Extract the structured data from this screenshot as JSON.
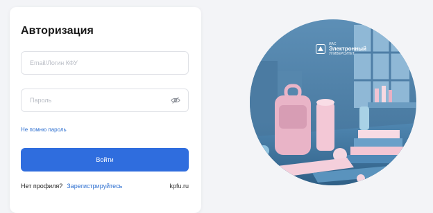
{
  "login": {
    "title": "Авторизация",
    "email_placeholder": "Email/Логин КФУ",
    "email_value": "",
    "password_placeholder": "Пароль",
    "password_value": "",
    "forgot_label": "Не помню пароль",
    "submit_label": "Войти",
    "no_profile_text": "Нет профиля?",
    "register_label": "Зарегистрируйтесь",
    "site_label": "kpfu.ru"
  },
  "brand": {
    "small_top": "ИАС",
    "name": "Электронный",
    "small_bottom": "УНИВЕРСИТЕТ"
  },
  "icons": {
    "password_toggle": "eye-slash-icon",
    "brand_emblem": "kpfu-emblem-icon"
  },
  "colors": {
    "primary": "#2f6dde",
    "link": "#2d6fd0",
    "background": "#f3f4f7"
  }
}
